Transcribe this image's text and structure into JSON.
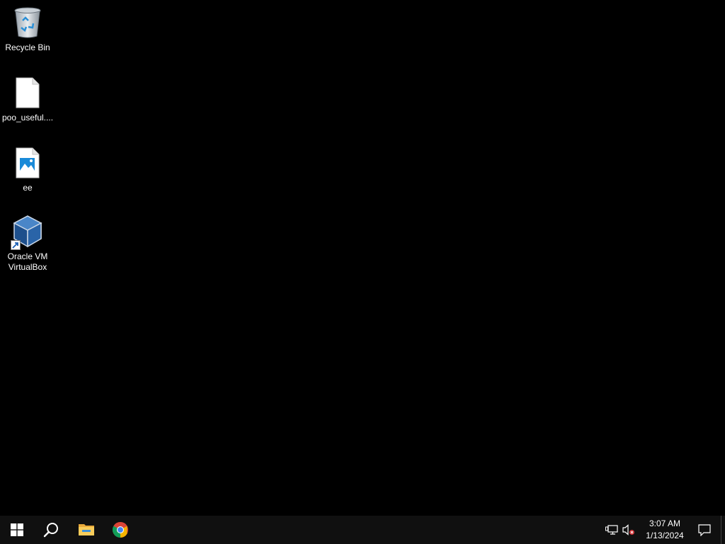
{
  "desktop": {
    "background_color": "#000000",
    "icons": [
      {
        "label": "Recycle Bin",
        "icon": "recycle-bin-icon"
      },
      {
        "label": "poo_useful....",
        "icon": "document-icon"
      },
      {
        "label": "ee",
        "icon": "image-file-icon"
      },
      {
        "label": "Oracle VM VirtualBox",
        "icon": "virtualbox-icon",
        "shortcut": true
      }
    ]
  },
  "taskbar": {
    "background_color": "#101010",
    "buttons": [
      {
        "name": "start",
        "icon": "windows-logo-icon"
      },
      {
        "name": "search",
        "icon": "search-icon"
      },
      {
        "name": "file-explorer",
        "icon": "folder-icon"
      },
      {
        "name": "chrome",
        "icon": "chrome-icon"
      }
    ],
    "tray": {
      "network_icon": "network-icon",
      "volume_icon": "volume-muted-icon",
      "time": "3:07 AM",
      "date": "1/13/2024",
      "notification_icon": "notification-icon"
    }
  }
}
